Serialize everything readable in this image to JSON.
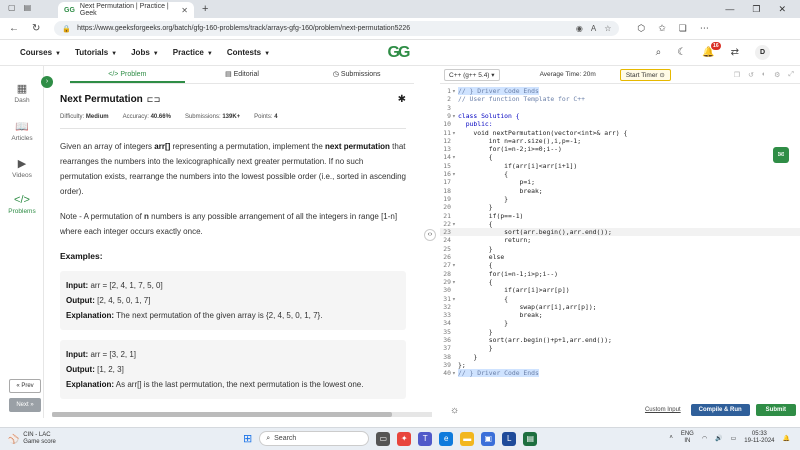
{
  "browser": {
    "tab_title": "Next Permutation | Practice | Geek",
    "url": "https://www.geeksforgeeks.org/batch/gfg-160-problems/track/arrays-gfg-160/problem/next-permutation5226"
  },
  "site": {
    "logo": "GG",
    "menu": [
      "Courses",
      "Tutorials",
      "Jobs",
      "Practice",
      "Contests"
    ],
    "notification_count": "16",
    "avatar_letter": "D"
  },
  "rail": {
    "items": [
      "Dash",
      "Articles",
      "Videos",
      "Problems"
    ],
    "prev": "« Prev",
    "next": "Next »"
  },
  "problem_tabs": [
    "Problem",
    "Editorial",
    "Submissions"
  ],
  "problem": {
    "title": "Next Permutation",
    "difficulty_label": "Difficulty:",
    "difficulty": "Medium",
    "accuracy_label": "Accuracy:",
    "accuracy": "40.66%",
    "submissions_label": "Submissions:",
    "submissions": "139K+",
    "points_label": "Points:",
    "points": "4",
    "desc_1": "Given an array of integers ",
    "desc_arr": "arr[]",
    "desc_2": " representing a permutation, implement the ",
    "desc_np": "next permutation",
    "desc_3": " that rearranges the numbers into the lexicographically next greater permutation. If no such permutation exists, rearrange the numbers into the lowest possible order (i.e., sorted in ascending order).",
    "note_1": "Note - A permutation of ",
    "note_n": "n",
    "note_2": " numbers is any possible arrangement of all the integers in range [1-n] where each integer occurs exactly once.",
    "examples_title": "Examples:",
    "examples": [
      {
        "input_label": "Input:",
        "input": "arr = [2, 4, 1, 7, 5, 0]",
        "output_label": "Output:",
        "output": "[2, 4, 5, 0, 1, 7]",
        "explanation_label": "Explanation:",
        "explanation": "The next permutation of the given array is {2, 4, 5, 0, 1, 7}."
      },
      {
        "input_label": "Input:",
        "input": "arr = [3, 2, 1]",
        "output_label": "Output:",
        "output": "[1, 2, 3]",
        "explanation_label": "Explanation:",
        "explanation": "As arr[] is the last permutation, the next permutation is the lowest one."
      }
    ]
  },
  "editor": {
    "language": "C++ (g++ 5.4)",
    "avg_time": "Average Time: 20m",
    "timer_label": "Start Timer",
    "code": [
      {
        "n": "1",
        "f": "▾",
        "t": "// } Driver Code Ends",
        "cls": "cm",
        "hl": true
      },
      {
        "n": "2",
        "f": "",
        "t": "// User function Template for C++",
        "cls": "cm"
      },
      {
        "n": "3",
        "f": "",
        "t": ""
      },
      {
        "n": "9",
        "f": "▾",
        "t": "class Solution {",
        "cls": "kw"
      },
      {
        "n": "10",
        "f": "",
        "t": "  public:",
        "cls": "kw"
      },
      {
        "n": "11",
        "f": "▾",
        "t": "    void nextPermutation(vector<int>& arr) {"
      },
      {
        "n": "12",
        "f": "",
        "t": "        int n=arr.size(),i,p=-1;"
      },
      {
        "n": "13",
        "f": "",
        "t": "        for(i=n-2;i>=0;i--)"
      },
      {
        "n": "14",
        "f": "▾",
        "t": "        {"
      },
      {
        "n": "15",
        "f": "",
        "t": "            if(arr[i]<arr[i+1])"
      },
      {
        "n": "16",
        "f": "▾",
        "t": "            {"
      },
      {
        "n": "17",
        "f": "",
        "t": "                p=i;"
      },
      {
        "n": "18",
        "f": "",
        "t": "                break;"
      },
      {
        "n": "19",
        "f": "",
        "t": "            }"
      },
      {
        "n": "20",
        "f": "",
        "t": "        }"
      },
      {
        "n": "21",
        "f": "",
        "t": "        if(p==-1)"
      },
      {
        "n": "22",
        "f": "▾",
        "t": "        {"
      },
      {
        "n": "23",
        "f": "",
        "t": "            sort(arr.begin(),arr.end());",
        "cur": true
      },
      {
        "n": "24",
        "f": "",
        "t": "            return;"
      },
      {
        "n": "25",
        "f": "",
        "t": "        }"
      },
      {
        "n": "26",
        "f": "",
        "t": "        else"
      },
      {
        "n": "27",
        "f": "▾",
        "t": "        {"
      },
      {
        "n": "28",
        "f": "",
        "t": "        for(i=n-1;i>p;i--)"
      },
      {
        "n": "29",
        "f": "▾",
        "t": "        {"
      },
      {
        "n": "30",
        "f": "",
        "t": "            if(arr[i]>arr[p])"
      },
      {
        "n": "31",
        "f": "▾",
        "t": "            {"
      },
      {
        "n": "32",
        "f": "",
        "t": "                swap(arr[i],arr[p]);"
      },
      {
        "n": "33",
        "f": "",
        "t": "                break;"
      },
      {
        "n": "34",
        "f": "",
        "t": "            }"
      },
      {
        "n": "35",
        "f": "",
        "t": "        }"
      },
      {
        "n": "36",
        "f": "",
        "t": "        sort(arr.begin()+p+1,arr.end());"
      },
      {
        "n": "37",
        "f": "",
        "t": "        }"
      },
      {
        "n": "38",
        "f": "",
        "t": "    }"
      },
      {
        "n": "39",
        "f": "",
        "t": "};"
      },
      {
        "n": "40",
        "f": "▾",
        "t": "// } Driver Code Ends",
        "cls": "cm",
        "hl": true
      }
    ],
    "custom_input": "Custom Input",
    "compile_run": "Compile & Run",
    "submit": "Submit"
  },
  "taskbar": {
    "weather_title": "CIN - LAC",
    "weather_sub": "Game score",
    "search": "Search",
    "lang_top": "ENG",
    "lang_bottom": "IN",
    "time": "05:33",
    "date": "19-11-2024"
  }
}
